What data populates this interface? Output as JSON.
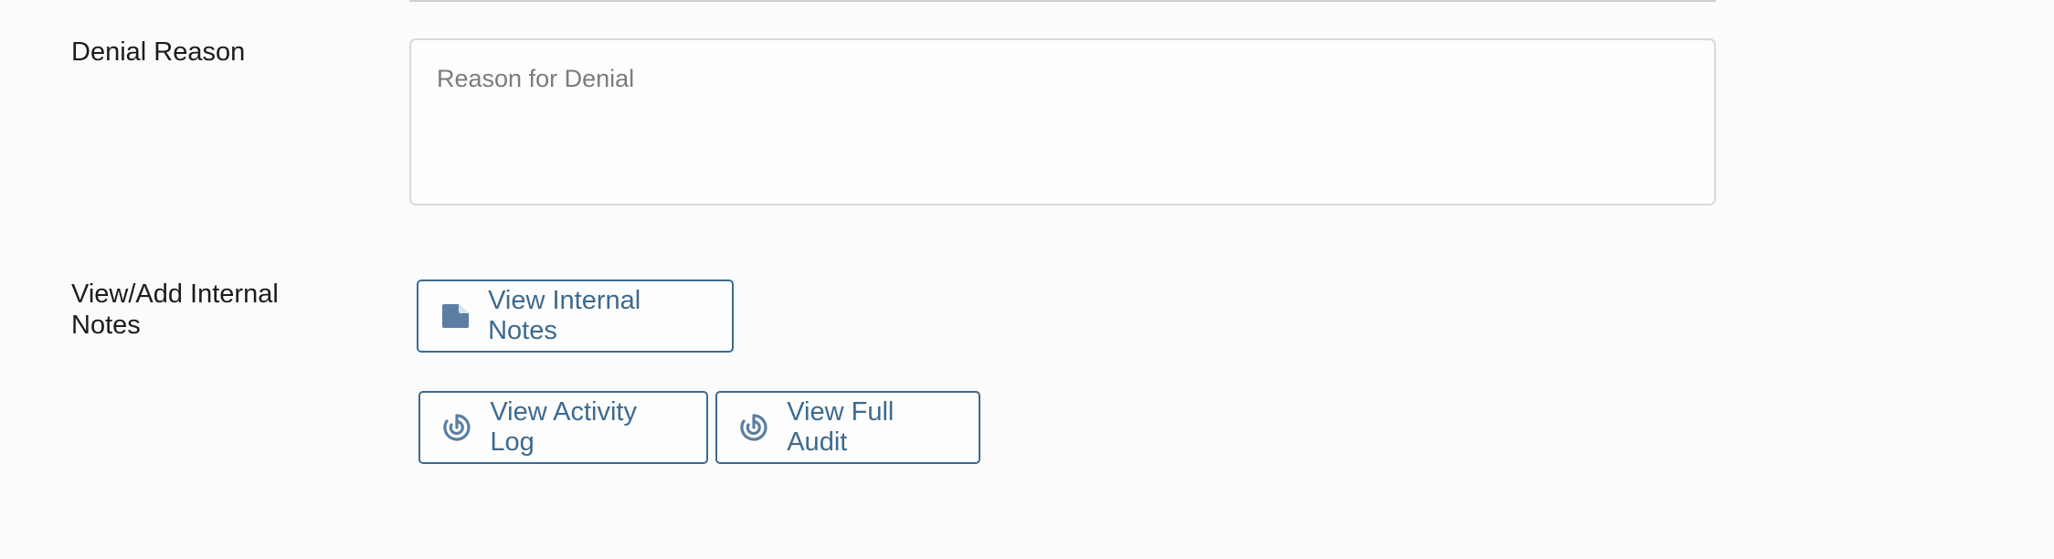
{
  "form": {
    "denial_reason": {
      "label": "Denial Reason",
      "placeholder": "Reason for Denial",
      "value": ""
    },
    "internal_notes": {
      "label": "View/Add Internal Notes",
      "button_label": "View Internal Notes",
      "button_icon": "note-icon"
    },
    "activity": {
      "activity_log_label": "View Activity Log",
      "full_audit_label": "View Full Audit",
      "icon": "history-icon"
    }
  },
  "colors": {
    "accent": "#3d6a8f",
    "icon_fill": "#5a7fa2",
    "border": "#d9d9d9",
    "background": "#fbfbfb"
  }
}
